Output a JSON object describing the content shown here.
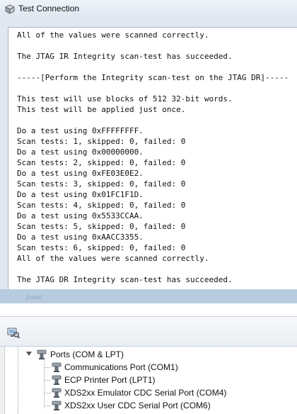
{
  "dialog": {
    "title": "Test Connection",
    "log_lines": [
      "All of the values were scanned correctly.",
      "",
      "The JTAG IR Integrity scan-test has succeeded.",
      "",
      "-----[Perform the Integrity scan-test on the JTAG DR]-----",
      "",
      "This test will use blocks of 512 32-bit words.",
      "This test will be applied just once.",
      "",
      "Do a test using 0xFFFFFFFF.",
      "Scan tests: 1, skipped: 0, failed: 0",
      "Do a test using 0x00000000.",
      "Scan tests: 2, skipped: 0, failed: 0",
      "Do a test using 0xFE03E0E2.",
      "Scan tests: 3, skipped: 0, failed: 0",
      "Do a test using 0x01FC1F1D.",
      "Scan tests: 4, skipped: 0, failed: 0",
      "Do a test using 0x5533CCAA.",
      "Scan tests: 5, skipped: 0, failed: 0",
      "Do a test using 0xAACC3355.",
      "Scan tests: 6, skipped: 0, failed: 0",
      "All of the values were scanned correctly.",
      "",
      "The JTAG DR Integrity scan-test has succeeded."
    ]
  },
  "background_window": {
    "tab_label": "(new)",
    "tree": {
      "category": "Ports (COM & LPT)",
      "items": [
        "Communications Port (COM1)",
        "ECP Printer Port (LPT1)",
        "XDS2xx Emulator CDC Serial Port (COM4)",
        "XDS2xx User CDC Serial Port (COM6)"
      ]
    }
  },
  "colors": {
    "dialog_background": "#dfe8f2",
    "log_background": "#ffffff",
    "taskbar_strip": "#b7ccdf",
    "port_icon": "#6b7480"
  },
  "icons": {
    "dialog_app": "cube-icon",
    "toolbar": "scan-hardware-icon",
    "ports_category": "port-connector-icon",
    "port_item": "port-connector-icon"
  }
}
